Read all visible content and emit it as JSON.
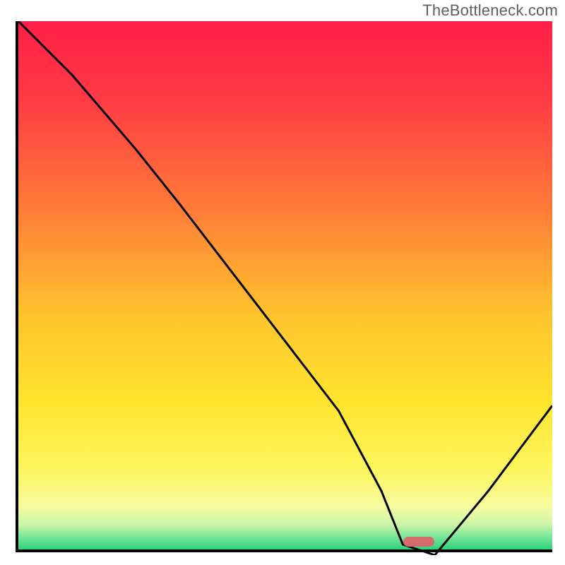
{
  "watermark": "TheBottleneck.com",
  "chart_data": {
    "type": "line",
    "title": "",
    "xlabel": "",
    "ylabel": "",
    "xlim": [
      0,
      100
    ],
    "ylim": [
      0,
      100
    ],
    "x": [
      0,
      10,
      22,
      30,
      40,
      50,
      60,
      68,
      72,
      78,
      88,
      100
    ],
    "values": [
      100,
      90,
      76,
      66,
      53,
      40,
      27,
      12,
      2,
      0,
      12,
      28
    ],
    "marker": {
      "x": 75,
      "y": 1.5
    },
    "gradient_stops": [
      {
        "offset": 0.0,
        "color": "#ff1f49"
      },
      {
        "offset": 0.15,
        "color": "#ff3b44"
      },
      {
        "offset": 0.35,
        "color": "#ff7a38"
      },
      {
        "offset": 0.55,
        "color": "#ffc22e"
      },
      {
        "offset": 0.72,
        "color": "#ffe42e"
      },
      {
        "offset": 0.85,
        "color": "#fdf65f"
      },
      {
        "offset": 0.92,
        "color": "#f6fca0"
      },
      {
        "offset": 0.955,
        "color": "#c7f3a8"
      },
      {
        "offset": 0.975,
        "color": "#7de79a"
      },
      {
        "offset": 1.0,
        "color": "#2bd27b"
      }
    ]
  }
}
